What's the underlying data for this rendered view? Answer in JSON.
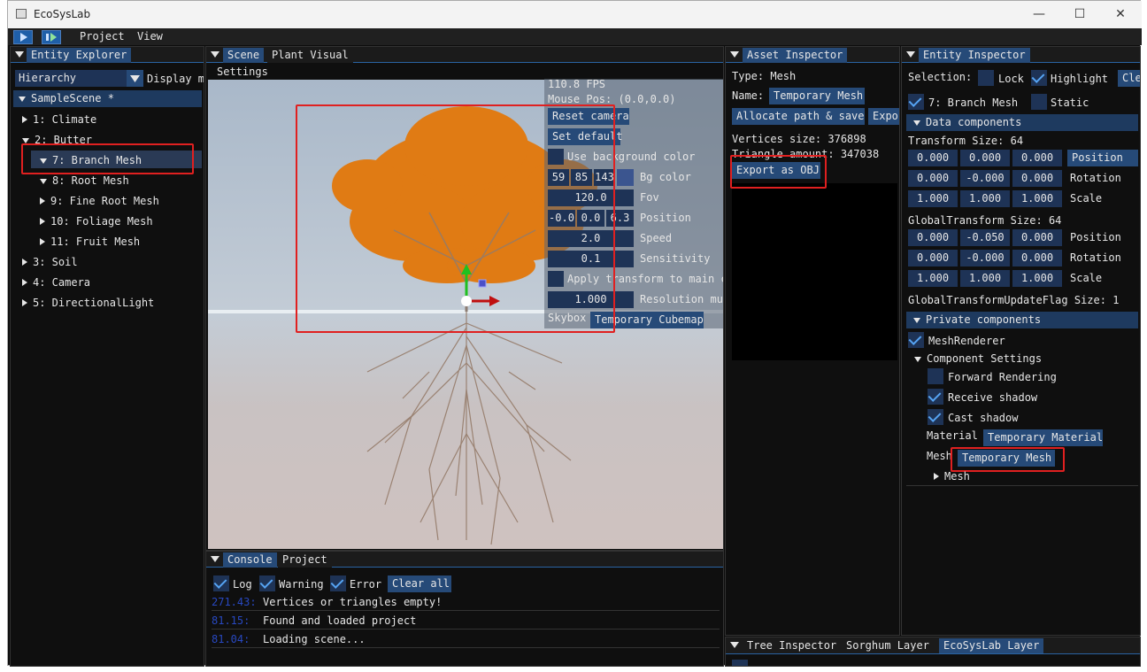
{
  "window": {
    "title": "EcoSysLab",
    "minimize": "—",
    "maximize": "☐",
    "close": "✕"
  },
  "menu": {
    "items": [
      "Project",
      "View"
    ]
  },
  "entity_explorer": {
    "tab": "Entity Explorer",
    "dropdown_value": "Hierarchy",
    "display_label": "Display m",
    "scene": "SampleScene *",
    "items": [
      "1: Climate",
      "2: Butter",
      "7: Branch Mesh",
      "8: Root Mesh",
      "9: Fine Root Mesh",
      "10: Foliage Mesh",
      "11: Fruit Mesh",
      "3: Soil",
      "4: Camera",
      "5: DirectionalLight"
    ]
  },
  "scene_panel": {
    "tabs": [
      "Scene",
      "Plant Visual"
    ],
    "settings_label": "Settings",
    "fps": "110.8 FPS",
    "mouse_pos": "Mouse Pos: (0.0,0.0)",
    "reset_camera": "Reset camera",
    "set_default": "Set default",
    "use_bg_color": "Use background color",
    "bg_r": "59",
    "bg_g": "85",
    "bg_b": "143",
    "bg_label": "Bg color",
    "fov_value": "120.0",
    "fov_label": "Fov",
    "pos_x": "-0.0",
    "pos_y": "0.0",
    "pos_z": "6.3",
    "pos_label": "Position",
    "speed_value": "2.0",
    "speed_label": "Speed",
    "sens_value": "0.1",
    "sens_label": "Sensitivity",
    "apply_transform": "Apply transform to main c",
    "res_value": "1.000",
    "res_label": "Resolution mul",
    "skybox_label": "Skybox",
    "skybox_value": "Temporary Cubemap"
  },
  "console": {
    "tabs": [
      "Console",
      "Project"
    ],
    "log": "Log",
    "warning": "Warning",
    "error": "Error",
    "clear_all": "Clear all",
    "entries": [
      {
        "time": "271.43:",
        "msg": "Vertices or triangles empty!"
      },
      {
        "time": "81.15:",
        "msg": "Found and loaded project"
      },
      {
        "time": "81.04:",
        "msg": "Loading scene..."
      }
    ]
  },
  "asset_inspector": {
    "tab": "Asset Inspector",
    "type": "Type: Mesh",
    "name_label": "Name:",
    "name_value": "Temporary Mesh",
    "allocate": "Allocate path & save",
    "export": "Expo",
    "vertices": "Vertices size: 376898",
    "triangles": "Triangle amount: 347038",
    "export_obj": "Export as OBJ"
  },
  "entity_inspector": {
    "tab": "Entity Inspector",
    "selection": "Selection:",
    "lock": "Lock",
    "highlight": "Highlight",
    "clear": "Clea",
    "entity_name": "7: Branch Mesh",
    "static": "Static",
    "data_components": "Data components",
    "transform_title": "Transform Size: 64",
    "transform_rows": [
      {
        "v": [
          "0.000",
          "0.000",
          "0.000"
        ],
        "label": "Position",
        "hl": true
      },
      {
        "v": [
          "0.000",
          "-0.000",
          "0.000"
        ],
        "label": "Rotation",
        "hl": false
      },
      {
        "v": [
          "1.000",
          "1.000",
          "1.000"
        ],
        "label": "Scale",
        "hl": false
      }
    ],
    "global_title": "GlobalTransform Size: 64",
    "global_rows": [
      {
        "v": [
          "0.000",
          "-0.050",
          "0.000"
        ],
        "label": "Position"
      },
      {
        "v": [
          "0.000",
          "-0.000",
          "0.000"
        ],
        "label": "Rotation"
      },
      {
        "v": [
          "1.000",
          "1.000",
          "1.000"
        ],
        "label": "Scale"
      }
    ],
    "flag": "GlobalTransformUpdateFlag Size: 1",
    "private_components": "Private components",
    "mesh_renderer": "MeshRenderer",
    "component_settings": "Component Settings",
    "forward_rendering": "Forward Rendering",
    "receive_shadow": "Receive shadow",
    "cast_shadow": "Cast shadow",
    "material_label": "Material",
    "material_value": "Temporary Material",
    "mesh_label": "Mesh",
    "mesh_value": "Temporary Mesh",
    "mesh_node": "Mesh"
  },
  "bottom_tabs": [
    "Tree Inspector",
    "Sorghum Layer",
    "EcoSysLab Layer"
  ],
  "colors": {
    "accent": "#264a78",
    "tree": "#e07b14",
    "root": "#9a8272",
    "highlight": "#e02020"
  }
}
